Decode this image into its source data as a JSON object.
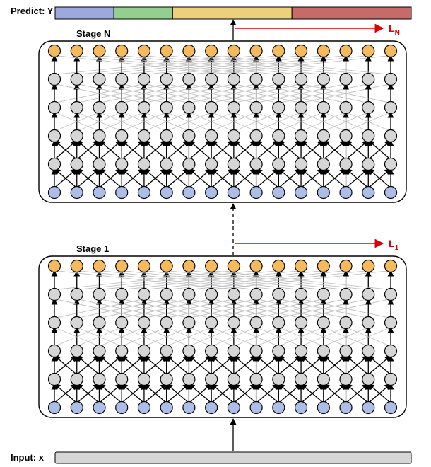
{
  "labels": {
    "predict": "Predict: Y",
    "input": "Input: x",
    "stageN": "Stage N",
    "stage1": "Stage 1",
    "lossN": "L",
    "lossN_sub": "N",
    "loss1": "L",
    "loss1_sub": "1"
  },
  "predict_bar": {
    "segments": [
      {
        "color": "#9da9dc",
        "width": 0.165
      },
      {
        "color": "#94cf8f",
        "width": 0.165
      },
      {
        "color": "#ecd07c",
        "width": 0.335
      },
      {
        "color": "#c76a6a",
        "width": 0.335
      }
    ]
  },
  "stage": {
    "cols": 16,
    "rows": 6,
    "node_radius": 8.5,
    "colors": {
      "input_row": "blue",
      "hidden_row": "gray",
      "output_row": "orange"
    },
    "connections_per_row": [
      {
        "fan": 1
      },
      {
        "fan": 1
      },
      {
        "fan": 2
      },
      {
        "fan": 4
      },
      {
        "fan": 8
      }
    ]
  },
  "chart_data": {
    "type": "diagram",
    "description": "Multi-stage dilated convolution / TCN architecture. Two stacked stages (Stage 1 bottom, Stage N top) each with 6 rows of 16 nodes: blue input row, 4 gray hidden rows with exponentially increasing receptive field (fan 1,1,2,4,8), orange output row. Output of Stage 1 feeds Stage N (dashed arrow). Top of Stage N feeds a 4-segment prediction bar Y. Per-stage losses L_1 and L_N branch off via red arrows.",
    "stages": [
      "Stage 1",
      "Stage N"
    ],
    "rows_per_stage": 6,
    "nodes_per_row": 16,
    "dilation_rates": [
      1,
      1,
      2,
      4,
      8
    ],
    "prediction_classes": 4,
    "prediction_class_proportions": [
      0.165,
      0.165,
      0.335,
      0.335
    ]
  }
}
